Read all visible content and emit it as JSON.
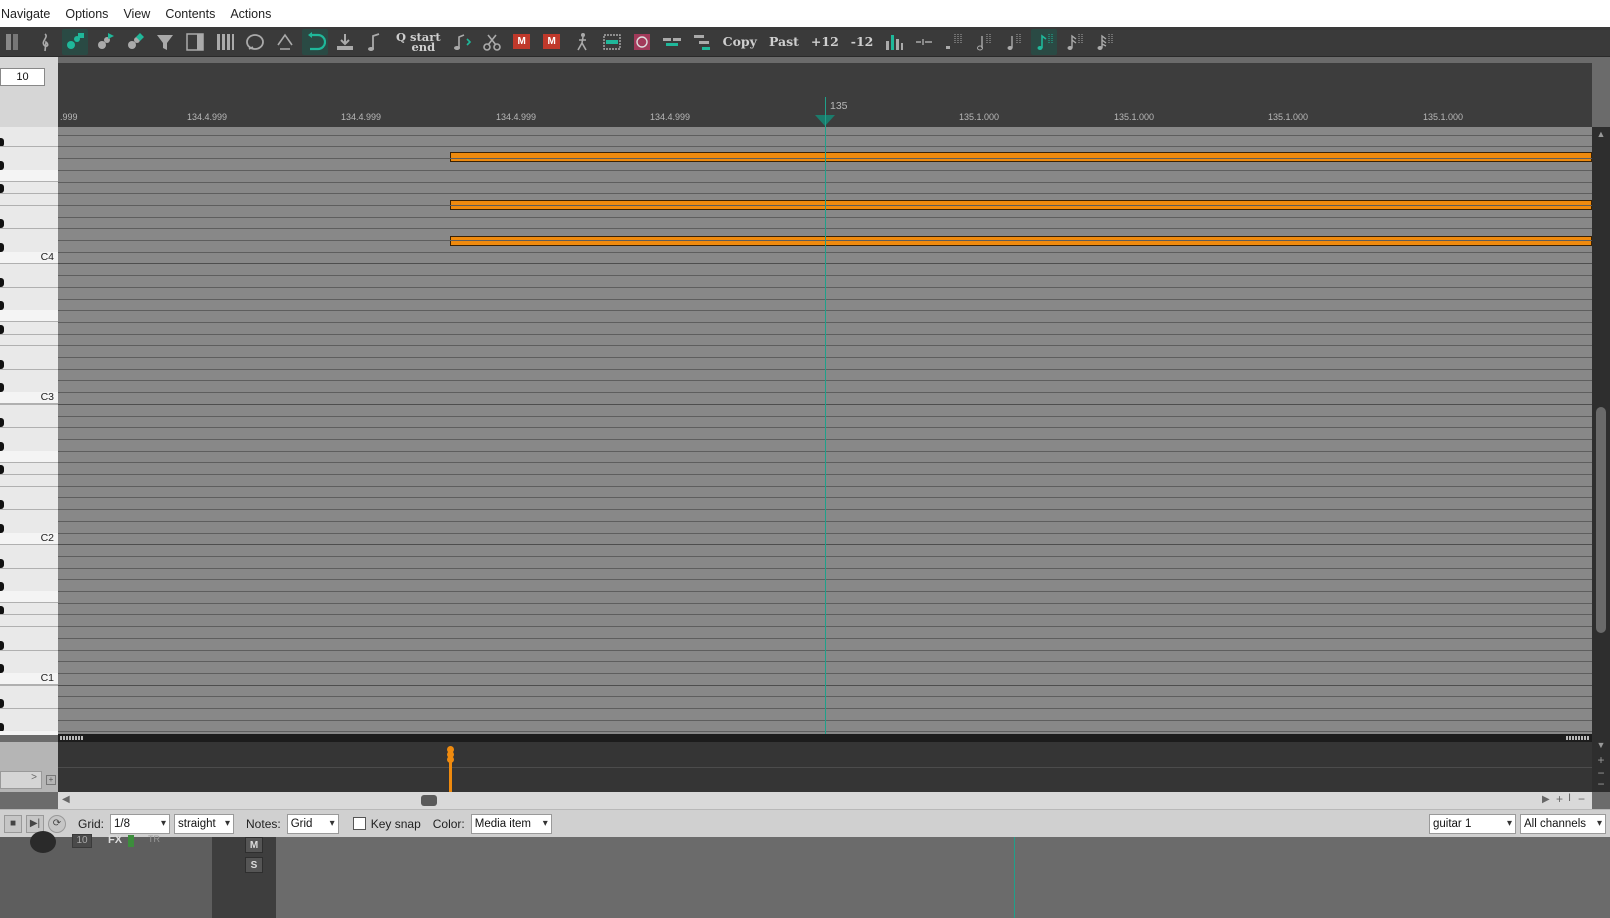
{
  "menu": [
    "Navigate",
    "Options",
    "View",
    "Contents",
    "Actions"
  ],
  "toolbar": {
    "qstart_top": "Q start",
    "qstart_bottom": "end",
    "copy_label": "Copy",
    "paste_label": "Past",
    "plus12_label": "+12",
    "minus12_label": "-12",
    "mute_label": "M",
    "mute2_label": "M",
    "accent_color": "#1fb89a"
  },
  "zoom_value": "10",
  "ruler": {
    "bar_label": "135",
    "labels": [
      ".999",
      "134.4.999",
      "134.4.999",
      "134.4.999",
      "134.4.999",
      "135.1.000",
      "135.1.000",
      "135.1.000",
      "135.1.000"
    ]
  },
  "keyboard": {
    "labels": [
      "C4",
      "C3",
      "C2",
      "C1"
    ]
  },
  "notes_color": "#ef8a0e",
  "cc_lane": {
    "selector": ">"
  },
  "bottom": {
    "grid_label": "Grid:",
    "grid_value": "1/8",
    "swing_value": "straight",
    "notes_label": "Notes:",
    "notes_value": "Grid",
    "key_snap_label": "Key snap",
    "key_snap_checked": false,
    "color_label": "Color:",
    "color_value": "Media item",
    "track_value": "guitar 1",
    "channel_value": "All channels"
  },
  "track": {
    "number": "10",
    "fx_label": "FX",
    "tr_label": "TR",
    "m_label": "M",
    "s_label": "S"
  }
}
